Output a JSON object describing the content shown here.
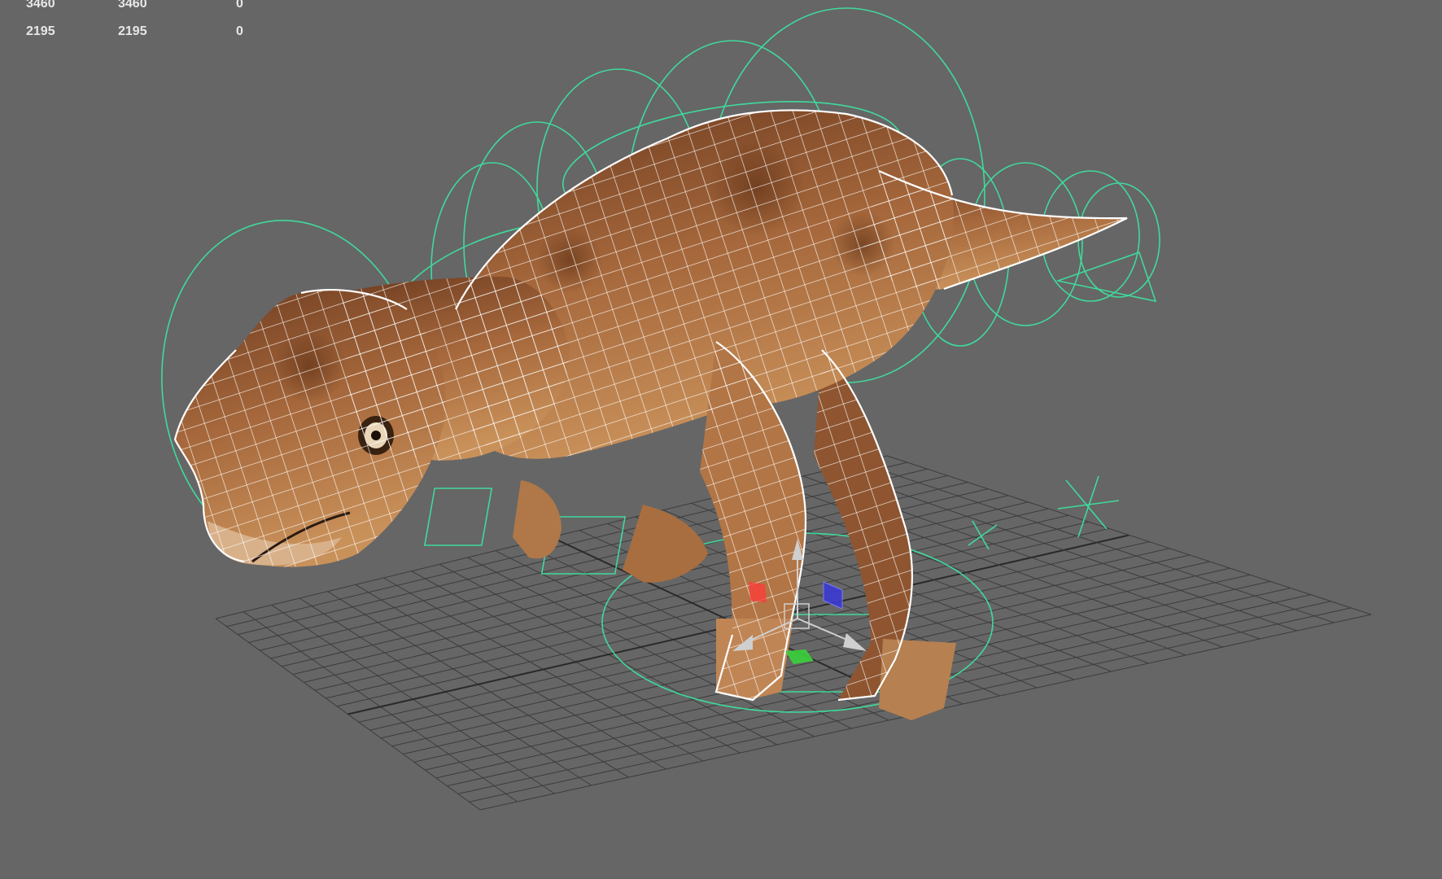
{
  "heads_up_display": {
    "rows": [
      {
        "col1": "3460",
        "col2": "3460",
        "col3": "0"
      },
      {
        "col1": "2195",
        "col2": "2195",
        "col3": "0"
      }
    ]
  },
  "viewport": {
    "object": "dinosaur-mesh",
    "display_mode": "wireframe-on-shaded",
    "grid": true,
    "manipulator": "move-tool",
    "colors": {
      "background": "#666666",
      "grid": "#3a3a3a",
      "grid_axis": "#2a2a2a",
      "rig_controls": "#3fe0a0",
      "wireframe": "#ffffff",
      "skin_dark": "#7a4526",
      "skin_light": "#c08350",
      "manipulator_x": "#ff3a3a",
      "manipulator_y": "#3ad23a",
      "manipulator_z": "#3a3ad2"
    }
  }
}
